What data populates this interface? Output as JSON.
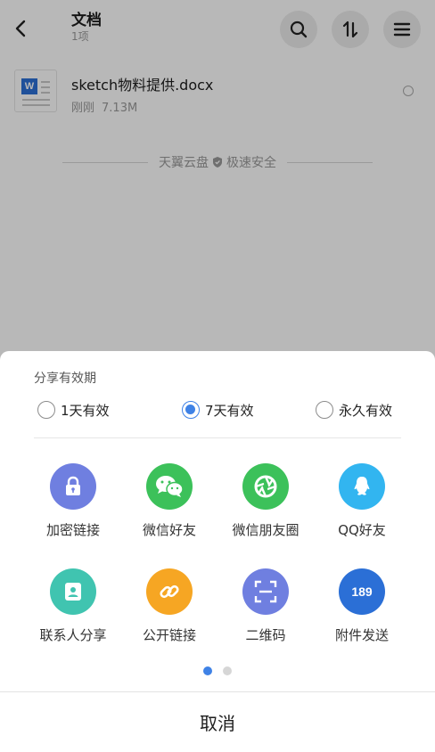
{
  "header": {
    "title": "文档",
    "subtitle": "1项"
  },
  "file": {
    "icon_letter": "W",
    "name": "sketch物料提供.docx",
    "time": "刚刚",
    "size": "7.13M"
  },
  "brand": {
    "left": "天翼云盘",
    "right": "极速安全"
  },
  "share": {
    "validity_label": "分享有效期",
    "options": [
      {
        "label": "1天有效",
        "checked": false
      },
      {
        "label": "7天有效",
        "checked": true
      },
      {
        "label": "永久有效",
        "checked": false
      }
    ],
    "items": [
      {
        "label": "加密链接",
        "icon": "lock-icon",
        "color": "#6f7fe0"
      },
      {
        "label": "微信好友",
        "icon": "wechat-icon",
        "color": "#3cc15a"
      },
      {
        "label": "微信朋友圈",
        "icon": "moments-icon",
        "color": "#3cc15a"
      },
      {
        "label": "QQ好友",
        "icon": "qq-icon",
        "color": "#32b5f0"
      },
      {
        "label": "联系人分享",
        "icon": "contact-icon",
        "color": "#40c4b0"
      },
      {
        "label": "公开链接",
        "icon": "link-icon",
        "color": "#f6a623"
      },
      {
        "label": "二维码",
        "icon": "qrcode-scan-icon",
        "color": "#6f7fe0"
      },
      {
        "label": "附件发送",
        "icon": "mail-189-icon",
        "color": "#2b6fd6",
        "badge": "189"
      }
    ],
    "page_count": 2,
    "active_page": 1,
    "cancel_label": "取消"
  }
}
